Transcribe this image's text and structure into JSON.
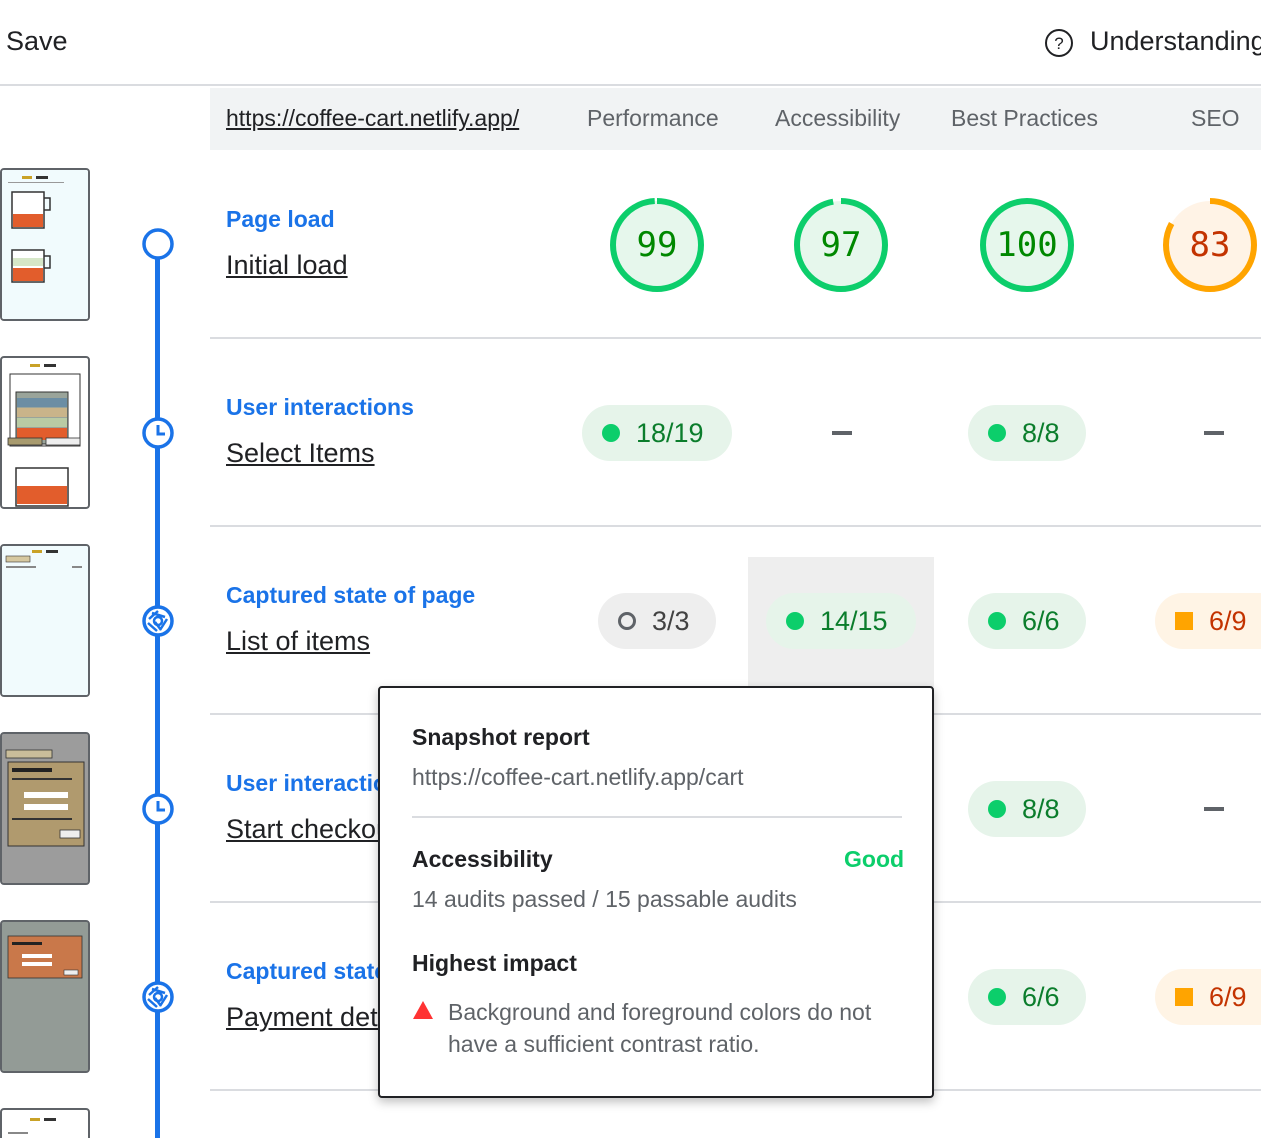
{
  "toolbar": {
    "save_label": "Save",
    "help_label": "Understanding"
  },
  "header": {
    "url": "https://coffee-cart.netlify.app/",
    "columns": [
      "Performance",
      "Accessibility",
      "Best Practices",
      "SEO"
    ]
  },
  "steps": [
    {
      "type": "Page load",
      "name": "Initial load",
      "icon": "navigation-circle-icon"
    },
    {
      "type": "User interactions",
      "name": "Select Items",
      "icon": "timespan-clock-icon"
    },
    {
      "type": "Captured state of page",
      "name": "List of items",
      "icon": "snapshot-aperture-icon"
    },
    {
      "type": "User interactions",
      "name": "Start checkout",
      "icon": "timespan-clock-icon"
    },
    {
      "type": "Captured state of page",
      "name": "Payment details",
      "icon": "snapshot-aperture-icon"
    }
  ],
  "scores": {
    "row1": [
      {
        "value": "99",
        "score": 99,
        "color": "#0cce6b",
        "text_color": "#008800",
        "fill": "#e6f7ec"
      },
      {
        "value": "97",
        "score": 97,
        "color": "#0cce6b",
        "text_color": "#008800",
        "fill": "#e6f7ec"
      },
      {
        "value": "100",
        "score": 100,
        "color": "#0cce6b",
        "text_color": "#008800",
        "fill": "#e6f7ec"
      },
      {
        "value": "83",
        "score": 83,
        "color": "#ffa400",
        "text_color": "#c33300",
        "fill": "#fff3e6"
      }
    ],
    "row2": [
      "18/19",
      "–",
      "8/8",
      "–"
    ],
    "row3": [
      "3/3",
      "14/15",
      "6/6",
      "6/9"
    ],
    "row4": [
      "8/8",
      "–"
    ],
    "row5": [
      "6/6",
      "6/9"
    ]
  },
  "tooltip": {
    "title": "Snapshot report",
    "url": "https://coffee-cart.netlify.app/cart",
    "category": "Accessibility",
    "rating": "Good",
    "audits": "14 audits passed / 15 passable audits",
    "impact_title": "Highest impact",
    "issue": "Background and foreground colors do not have a sufficient contrast ratio."
  },
  "colors": {
    "accent": "#1a73e8",
    "pass": "#0cce6b",
    "average": "#ffa400",
    "fail": "#ff4e42"
  }
}
